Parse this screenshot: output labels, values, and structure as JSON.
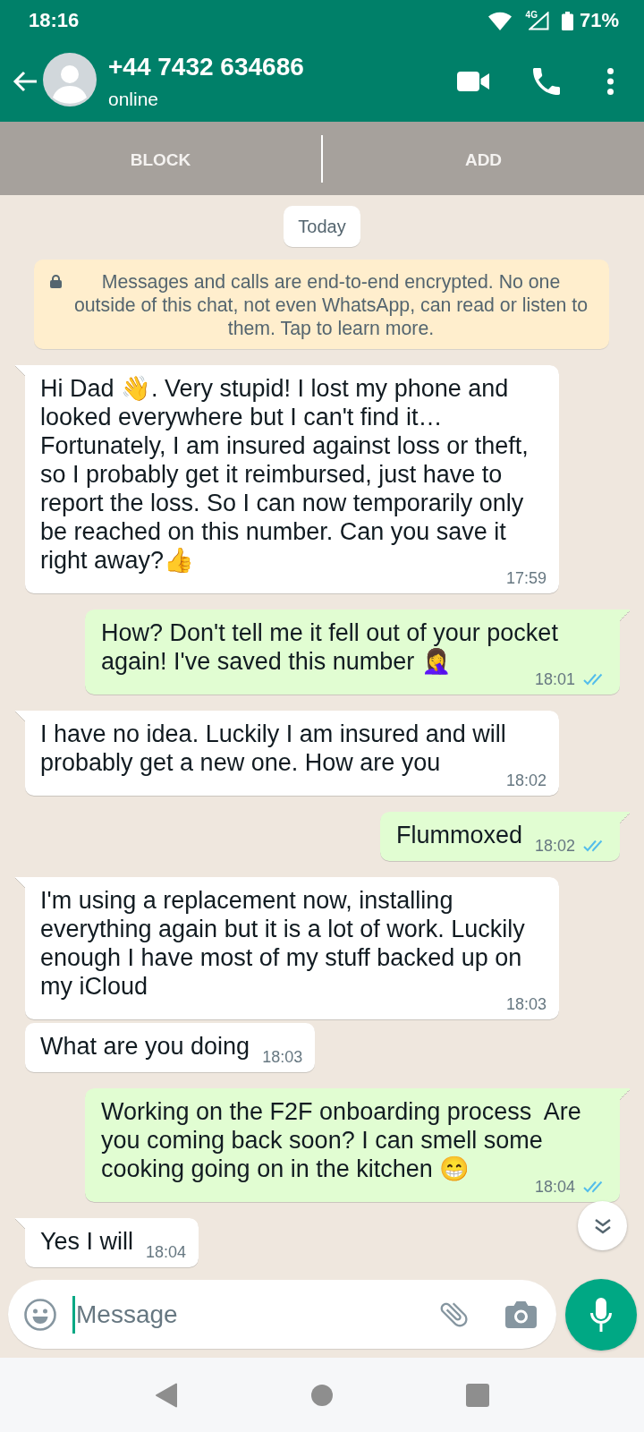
{
  "status_bar": {
    "time": "18:16",
    "network": "4G",
    "battery": "71%"
  },
  "header": {
    "title": "+44 7432 634686",
    "subtitle": "online"
  },
  "action_bar": {
    "buttons": [
      "BLOCK",
      "ADD"
    ]
  },
  "chat": {
    "date_chip": "Today",
    "encryption_notice": "Messages and calls are end-to-end encrypted. No one outside of this chat, not even WhatsApp, can read or listen to them. Tap to learn more.",
    "messages": [
      {
        "kind": "incoming",
        "text": "Hi Dad 👋. Very stupid! I lost my phone and looked everywhere but I can't find it… Fortunately, I am insured against loss or theft, so I probably get it reimbursed, just have to report the loss. So I can now temporarily only be reached on this number. Can you save it right away?👍",
        "time": "17:59"
      },
      {
        "kind": "outgoing",
        "text": "How? Don't tell me it fell out of your pocket again! I've saved this number 🤦‍♀️",
        "time": "18:01",
        "read": true
      },
      {
        "kind": "incoming",
        "text": "I have no idea. Luckily I am insured and will probably get a new one. How are you",
        "time": "18:02"
      },
      {
        "kind": "outgoing",
        "text": "Flummoxed",
        "time": "18:02",
        "read": true
      },
      {
        "kind": "incoming",
        "text": "I'm using a replacement now, installing everything again but it is a lot of work. Luckily enough I have most of my stuff backed up on my iCloud",
        "time": "18:03"
      },
      {
        "kind": "incoming",
        "text": "What are you doing",
        "time": "18:03"
      },
      {
        "kind": "outgoing",
        "text": "Working on the F2F onboarding process  Are you coming back soon? I can smell some cooking going on in the kitchen 😁",
        "time": "18:04",
        "read": true
      },
      {
        "kind": "incoming",
        "text": "Yes I will",
        "time": "18:04"
      }
    ]
  },
  "composer": {
    "placeholder": "Message",
    "focused": true
  }
}
